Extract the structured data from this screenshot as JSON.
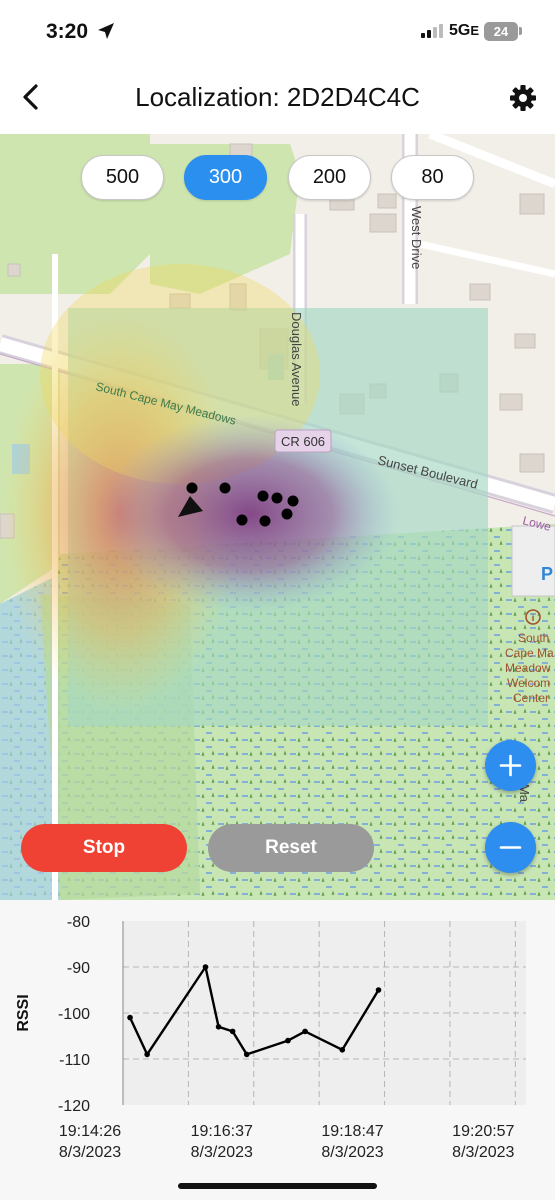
{
  "status_bar": {
    "time": "3:20",
    "network": "5G",
    "network_suffix": "E",
    "battery": "24"
  },
  "header": {
    "title": "Localization: 2D2D4C4C",
    "back_icon": "chevron-left-icon",
    "settings_icon": "gear-icon"
  },
  "radius_selector": {
    "options": [
      "500",
      "300",
      "200",
      "80"
    ],
    "selected": "300"
  },
  "map": {
    "street_labels": {
      "west_drive": "West Drive",
      "douglas_avenue": "Douglas Avenue",
      "south_cape_may_meadows": "South Cape May Meadows",
      "cr_606": "CR 606",
      "sunset_boulevard": "Sunset Boulevard",
      "lower": "Lowe",
      "poi_line1": "South",
      "poi_line2": "Cape Ma",
      "poi_line3": "Meadow",
      "poi_line4": "Welcom",
      "poi_line5": "Center",
      "right_vertical": "Ma",
      "parking": "P"
    },
    "zoom_in_icon": "plus-icon",
    "zoom_out_icon": "minus-icon",
    "heatmap_colors": [
      "#d9604a",
      "#f2d85a",
      "#b7e07a",
      "#9ad4f0",
      "#8a3c86"
    ]
  },
  "controls": {
    "stop_label": "Stop",
    "reset_label": "Reset",
    "stop_color": "#ef4234",
    "reset_color": "#9a9a9a"
  },
  "chart_data": {
    "type": "line",
    "ylabel": "RSSI",
    "ylim": [
      -120,
      -80
    ],
    "yticks": [
      "-80",
      "-90",
      "-100",
      "-110",
      "-120"
    ],
    "xticks": [
      {
        "time": "19:14:26",
        "date": "8/3/2023"
      },
      {
        "time": "19:16:37",
        "date": "8/3/2023"
      },
      {
        "time": "19:18:47",
        "date": "8/3/2023"
      },
      {
        "time": "19:20:57",
        "date": "8/3/2023"
      }
    ],
    "grid": true,
    "series": [
      {
        "x": [
          "19:14:33",
          "19:14:50",
          "19:15:48",
          "19:16:01",
          "19:16:15",
          "19:16:29",
          "19:17:10",
          "19:17:27",
          "19:18:04",
          "19:18:40"
        ],
        "values": [
          -101,
          -109,
          -90,
          -103,
          -104,
          -109,
          -106,
          -104,
          -108,
          -95
        ]
      }
    ]
  }
}
